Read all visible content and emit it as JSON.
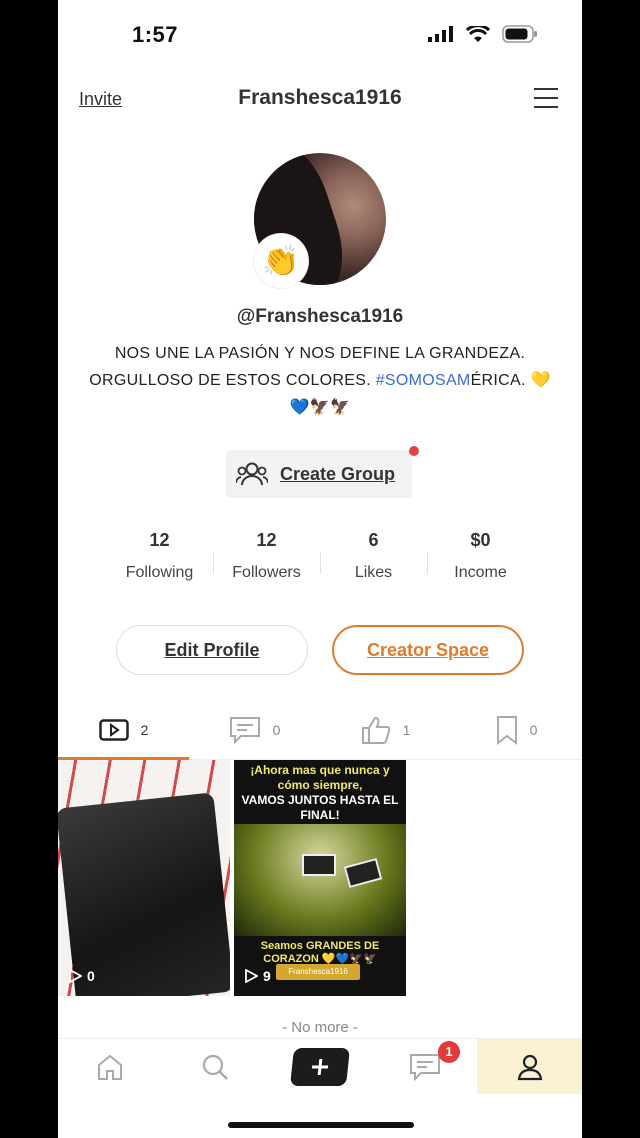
{
  "status": {
    "time": "1:57"
  },
  "header": {
    "invite_label": "Invite",
    "title": "Franshesca1916"
  },
  "profile": {
    "handle": "@Franshesca1916",
    "badge_emoji": "👏",
    "bio_line1": "NOS UNE LA PASIÓN Y NOS DEFINE LA GRANDEZA.",
    "bio_line2_prefix": "ORGULLOSO DE ESTOS COLORES. ",
    "bio_tag": "#SOMOSAM",
    "bio_line2_suffix": "ÉRICA. 💛",
    "bio_line3": "💙🦅🦅",
    "create_group_label": "Create Group"
  },
  "stats": [
    {
      "value": "12",
      "label": "Following"
    },
    {
      "value": "12",
      "label": "Followers"
    },
    {
      "value": "6",
      "label": "Likes"
    },
    {
      "value": "$0",
      "label": "Income"
    }
  ],
  "buttons": {
    "edit_profile": "Edit Profile",
    "creator_space": "Creator Space"
  },
  "tabs": [
    {
      "icon": "video-icon",
      "count": "2"
    },
    {
      "icon": "comment-icon",
      "count": "0"
    },
    {
      "icon": "like-icon",
      "count": "1"
    },
    {
      "icon": "bookmark-icon",
      "count": "0"
    }
  ],
  "videos": [
    {
      "views": "0"
    },
    {
      "views": "9",
      "top_text_1": "¡Ahora mas que nunca y cómo siempre,",
      "top_text_2": "VAMOS JUNTOS HASTA EL FINAL!",
      "bottom_text": "Seamos GRANDES DE CORAZON 💛💙🦅🦅",
      "stamp": "Franshesca1916"
    }
  ],
  "no_more": "- No more -",
  "nav": {
    "messages_badge": "1"
  },
  "colors": {
    "accent": "#e07a2c",
    "tag_blue": "#3a6bd8",
    "badge_red": "#e23a3a",
    "nav_active": "#fbf2d6"
  }
}
